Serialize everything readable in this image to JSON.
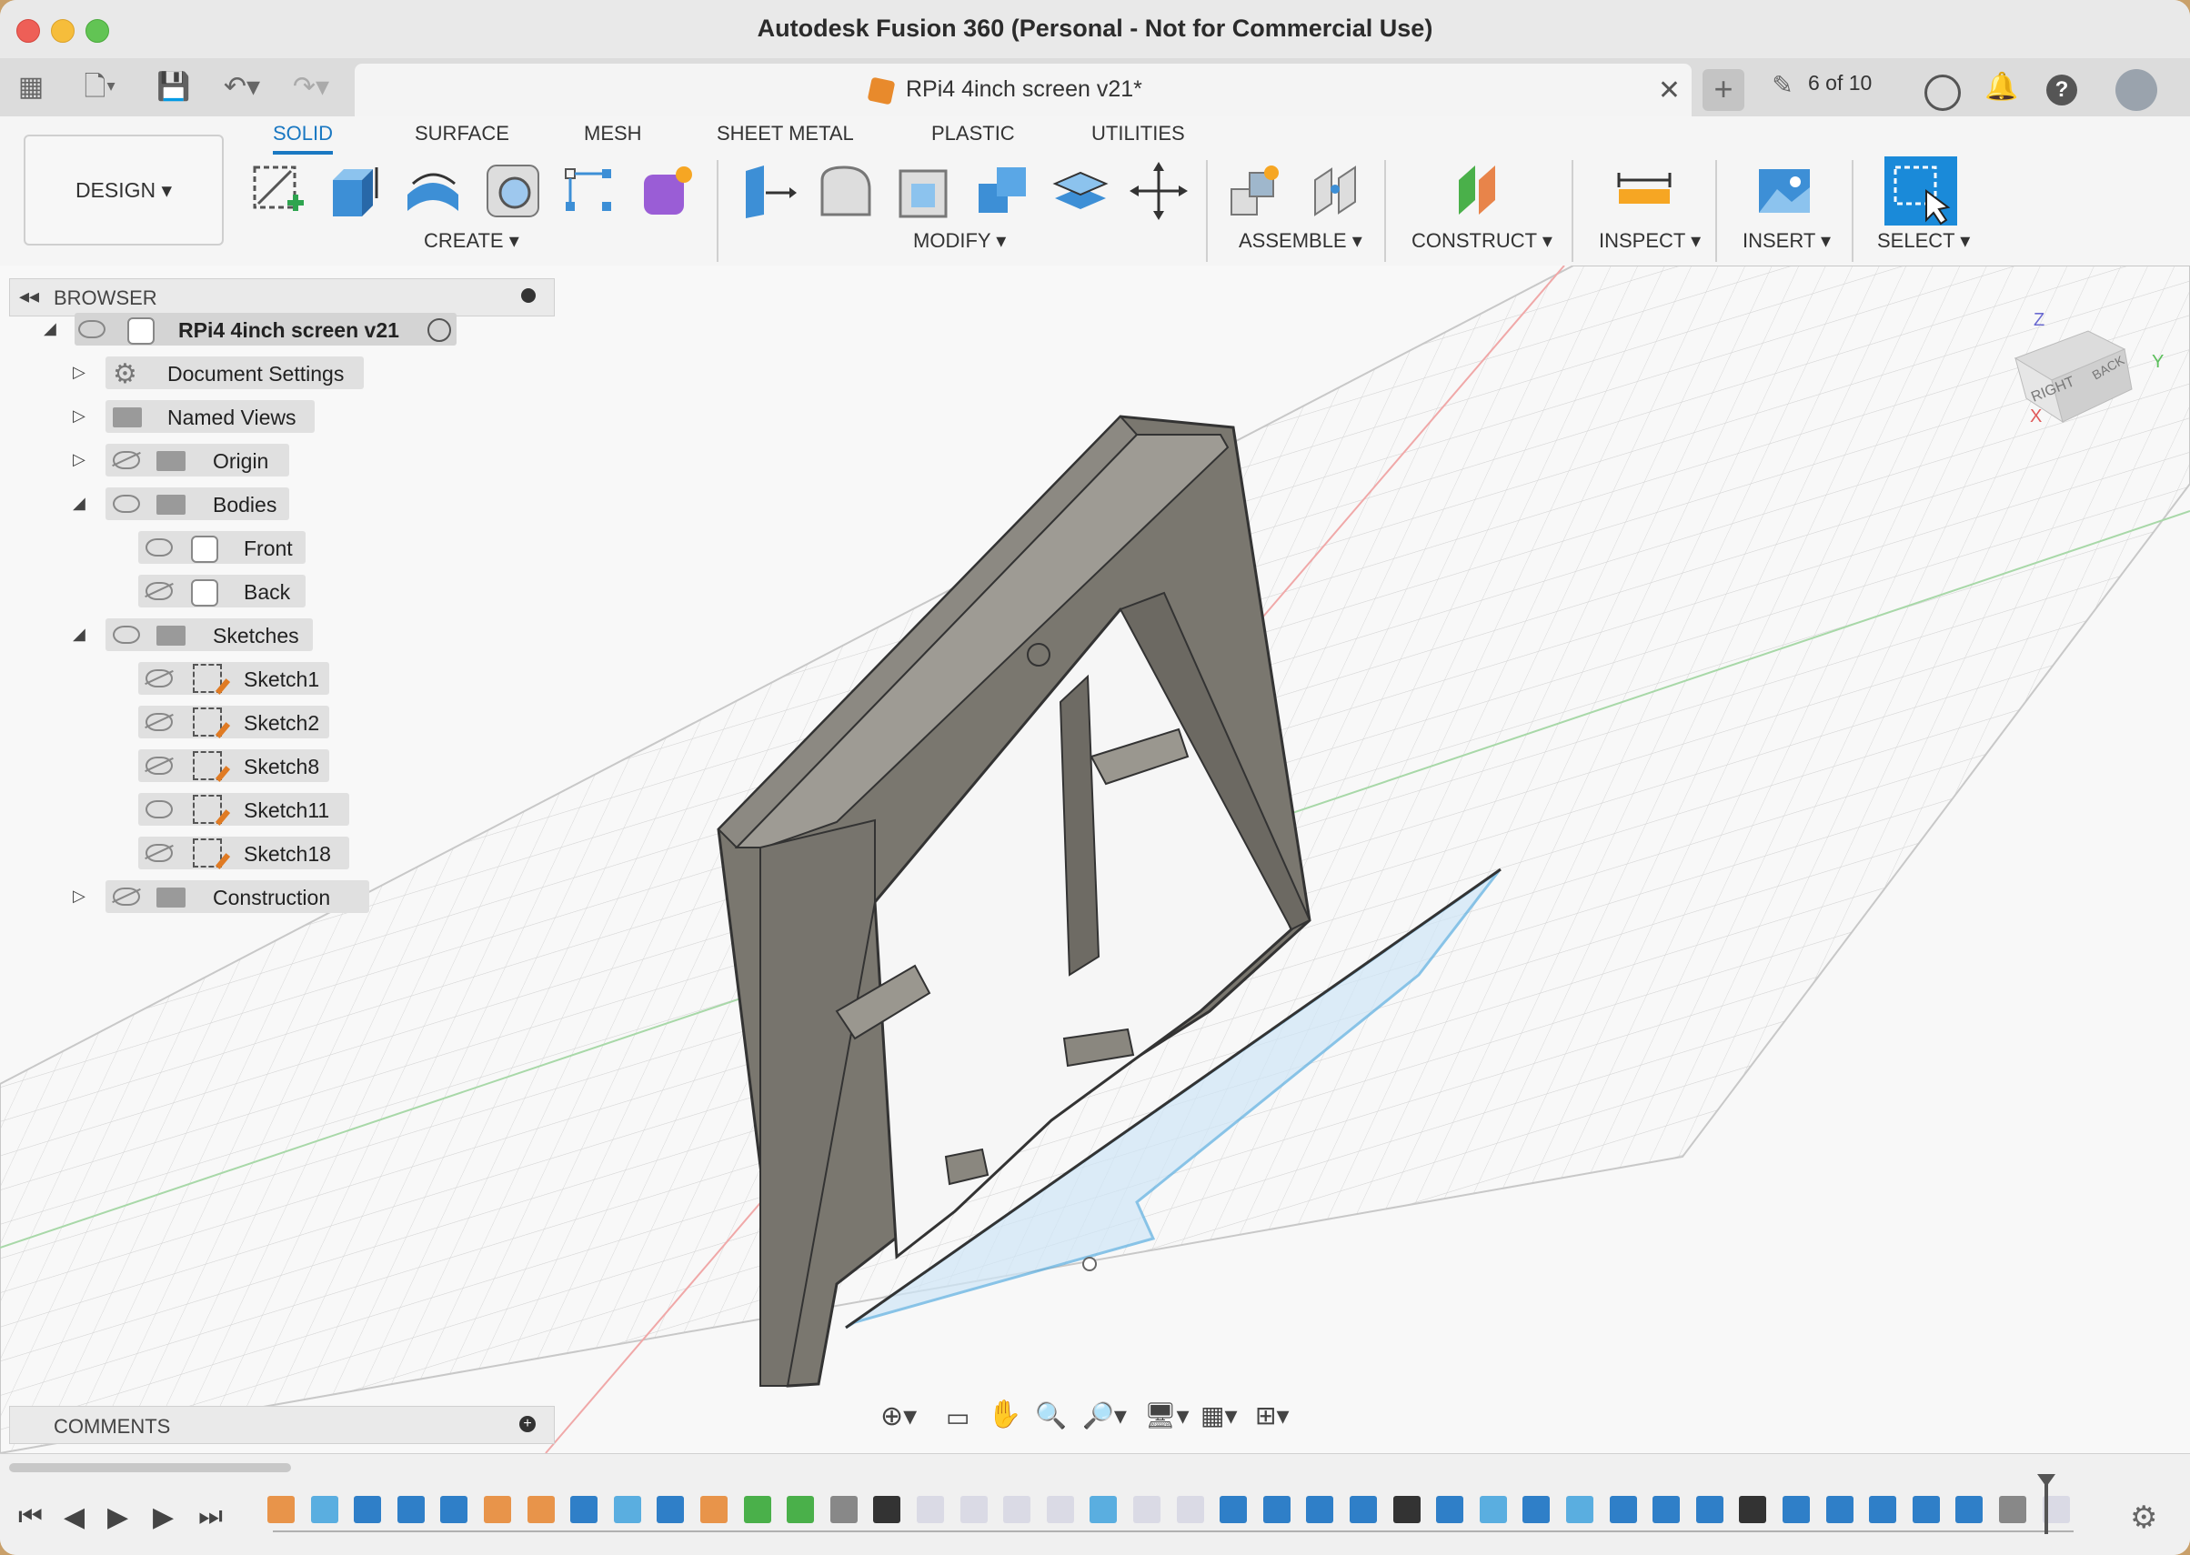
{
  "window": {
    "title": "Autodesk Fusion 360 (Personal - Not for Commercial Use)"
  },
  "document_tab": {
    "name": "RPi4 4inch screen v21*"
  },
  "jobs": {
    "label": "6 of 10"
  },
  "toolbar": {
    "workspace": "DESIGN",
    "tabs": [
      "SOLID",
      "SURFACE",
      "MESH",
      "SHEET METAL",
      "PLASTIC",
      "UTILITIES"
    ],
    "active_tab": "SOLID",
    "groups": [
      "CREATE",
      "MODIFY",
      "ASSEMBLE",
      "CONSTRUCT",
      "INSERT",
      "SELECT"
    ],
    "inspect_label": "INSPECT"
  },
  "browser": {
    "title": "BROWSER",
    "root": "RPi4 4inch screen v21",
    "items": [
      {
        "label": "Document Settings",
        "icon": "gear-icon"
      },
      {
        "label": "Named Views",
        "icon": "folder-icon"
      },
      {
        "label": "Origin",
        "icon": "folder-icon",
        "visible": false
      },
      {
        "label": "Bodies",
        "icon": "folder-icon",
        "visible": true
      },
      {
        "label": "Front",
        "icon": "body-icon",
        "visible": true
      },
      {
        "label": "Back",
        "icon": "body-icon",
        "visible": false
      },
      {
        "label": "Sketches",
        "icon": "folder-icon",
        "visible": true
      },
      {
        "label": "Sketch1",
        "icon": "sketch-icon",
        "visible": false
      },
      {
        "label": "Sketch2",
        "icon": "sketch-icon",
        "visible": false
      },
      {
        "label": "Sketch8",
        "icon": "sketch-icon",
        "visible": false
      },
      {
        "label": "Sketch11",
        "icon": "sketch-icon",
        "visible": true
      },
      {
        "label": "Sketch18",
        "icon": "sketch-icon",
        "visible": false
      },
      {
        "label": "Construction",
        "icon": "folder-icon",
        "visible": false
      }
    ]
  },
  "comments": {
    "title": "COMMENTS"
  },
  "viewcube": {
    "face_label": "RIGHT",
    "back_label": "BACK",
    "axes": [
      "Z",
      "Y",
      "X"
    ]
  },
  "colors": {
    "accent": "#1a78c2",
    "sketch": "#5aaee0",
    "body": "#7a776f"
  }
}
